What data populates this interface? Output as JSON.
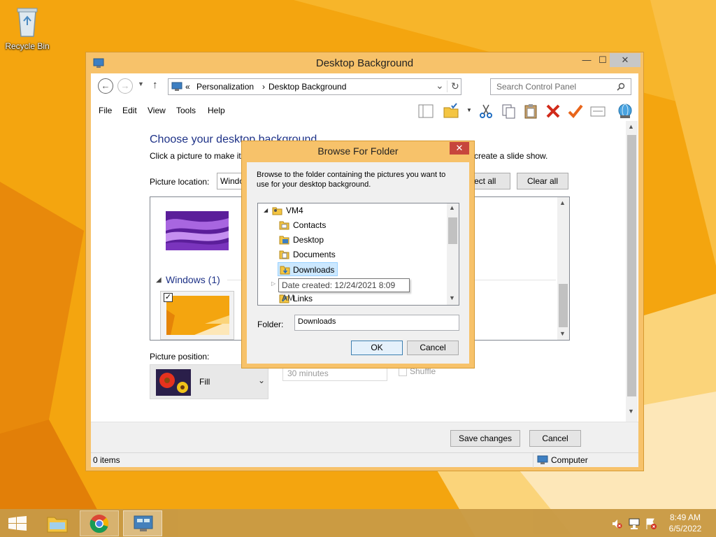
{
  "desktop": {
    "recycle_bin_label": "Recycle Bin"
  },
  "window": {
    "title": "Desktop Background",
    "controls": {
      "minimize": "—",
      "maximize": "☐",
      "close": "✕"
    },
    "address": {
      "overflow": "«",
      "crumb1": "Personalization",
      "sep": "›",
      "crumb2": "Desktop Background",
      "dropdown": "⌄",
      "refresh": "↻"
    },
    "search_placeholder": "Search Control Panel",
    "menu": {
      "file": "File",
      "edit": "Edit",
      "view": "View",
      "tools": "Tools",
      "help": "Help"
    },
    "heading": "Choose your desktop background",
    "subtext": "Click a picture to make it",
    "subtext_tail": "create a slide show.",
    "picture_location_label": "Picture location:",
    "picture_location_value": "Windows Desktop Backgrounds",
    "select_all_label": "Select all",
    "clear_all_label": "Clear all",
    "group_header": "Windows (1)",
    "picture_position_label": "Picture position:",
    "picture_position_value": "Fill",
    "interval_value": "30 minutes",
    "shuffle_label": "Shuffle",
    "save_label": "Save changes",
    "cancel_label": "Cancel",
    "status_items": "0 items",
    "status_computer": "Computer"
  },
  "dialog": {
    "title": "Browse For Folder",
    "close": "✕",
    "instructions": "Browse to the folder containing the pictures you want to use for your desktop background.",
    "tree": {
      "root": "VM4",
      "items": [
        "Contacts",
        "Desktop",
        "Documents",
        "Downloads",
        "Links"
      ],
      "selected": "Downloads"
    },
    "tooltip": "Date created: 12/24/2021 8:09 AM",
    "folder_label": "Folder:",
    "folder_value": "Downloads",
    "ok_label": "OK",
    "cancel_label": "Cancel"
  },
  "taskbar": {
    "time": "8:49 AM",
    "date": "6/5/2022"
  },
  "colors": {
    "wallpaper": "#f3a712",
    "window_frame": "#f7c26a",
    "taskbar": "#c99a45",
    "heading_blue": "#1e3287",
    "selection": "#cce8ff"
  }
}
